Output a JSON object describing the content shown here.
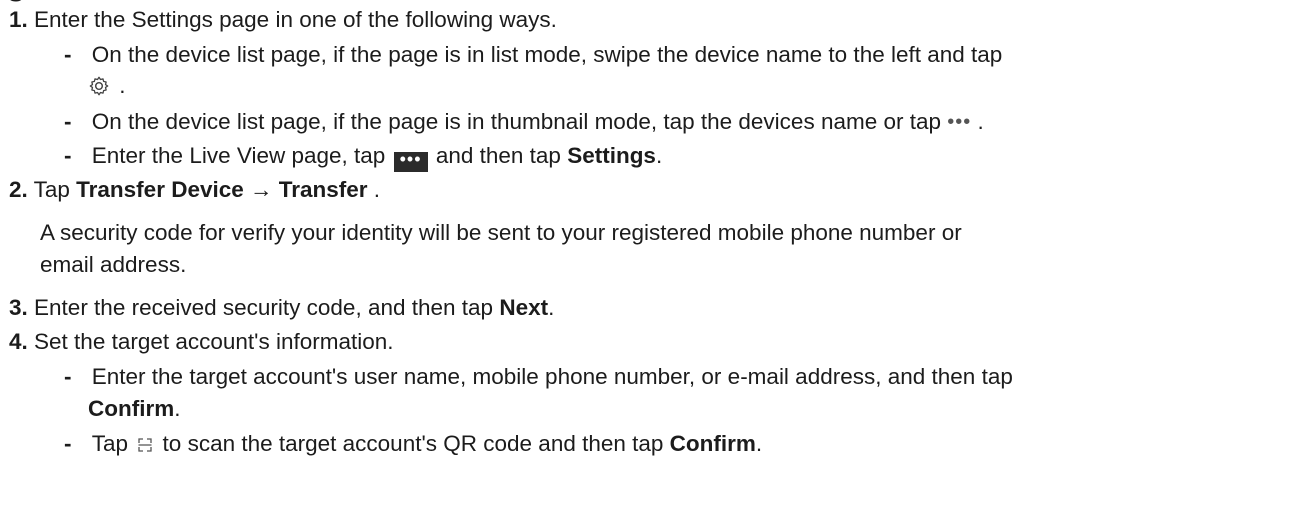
{
  "steps": [
    {
      "num": "1.",
      "text": "Enter the Settings page in one of the following ways."
    },
    {
      "num": "2.",
      "text_prefix": "Tap ",
      "text_bold": "Transfer Device → Transfer",
      "text_suffix": " ."
    },
    {
      "num": "3.",
      "text_prefix": "Enter the received security code, and then tap ",
      "text_bold": "Next",
      "text_suffix": "."
    },
    {
      "num": "4.",
      "text": "Set the target account's information."
    }
  ],
  "step1_bullets": [
    {
      "line1": "On the device list page, if the page is in list mode, swipe the device name to the left and tap",
      "line2_suffix": " ."
    },
    {
      "text_prefix": "On the device list page, if the page is in thumbnail mode, tap the devices name or tap ",
      "text_suffix": " ."
    },
    {
      "text_prefix": "Enter the Live View page, tap ",
      "text_mid": " and then tap ",
      "text_bold": "Settings",
      "text_suffix": "."
    }
  ],
  "step2_note": {
    "line1": "A security code for verify your identity will be sent to your registered mobile phone number or",
    "line2": "email address."
  },
  "step4_bullets": [
    {
      "line1": "Enter the target account's user name, mobile phone number, or e-mail address, and then tap",
      "line2_bold": "Confirm",
      "line2_suffix": "."
    },
    {
      "text_prefix": "Tap ",
      "text_mid": " to scan the target account's QR code and then tap ",
      "text_bold": "Confirm",
      "text_suffix": "."
    }
  ],
  "symbols": {
    "dash": "-",
    "dots": "•••"
  },
  "icons": [
    "gear-icon",
    "more-dots-icon",
    "more-button-icon",
    "scan-icon"
  ]
}
